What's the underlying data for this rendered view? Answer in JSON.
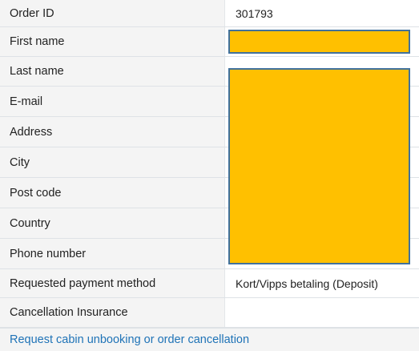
{
  "order": {
    "rows": [
      {
        "label": "Order ID",
        "value": "301793"
      },
      {
        "label": "First name",
        "value": ""
      },
      {
        "label": "Last name",
        "value": ""
      },
      {
        "label": "E-mail",
        "value": ""
      },
      {
        "label": "Address",
        "value": ""
      },
      {
        "label": "City",
        "value": ""
      },
      {
        "label": "Post code",
        "value": ""
      },
      {
        "label": "Country",
        "value": ""
      },
      {
        "label": "Phone number",
        "value": ""
      },
      {
        "label": "Requested payment method",
        "value": "Kort/Vipps betaling (Deposit)"
      },
      {
        "label": "Cancellation Insurance",
        "value": ""
      }
    ],
    "cancel_link": "Request cabin unbooking or order cancellation"
  },
  "colors": {
    "redaction_fill": "#ffc000",
    "redaction_border": "#41719c",
    "link": "#1f73b7",
    "label_bg": "#f4f4f4"
  }
}
